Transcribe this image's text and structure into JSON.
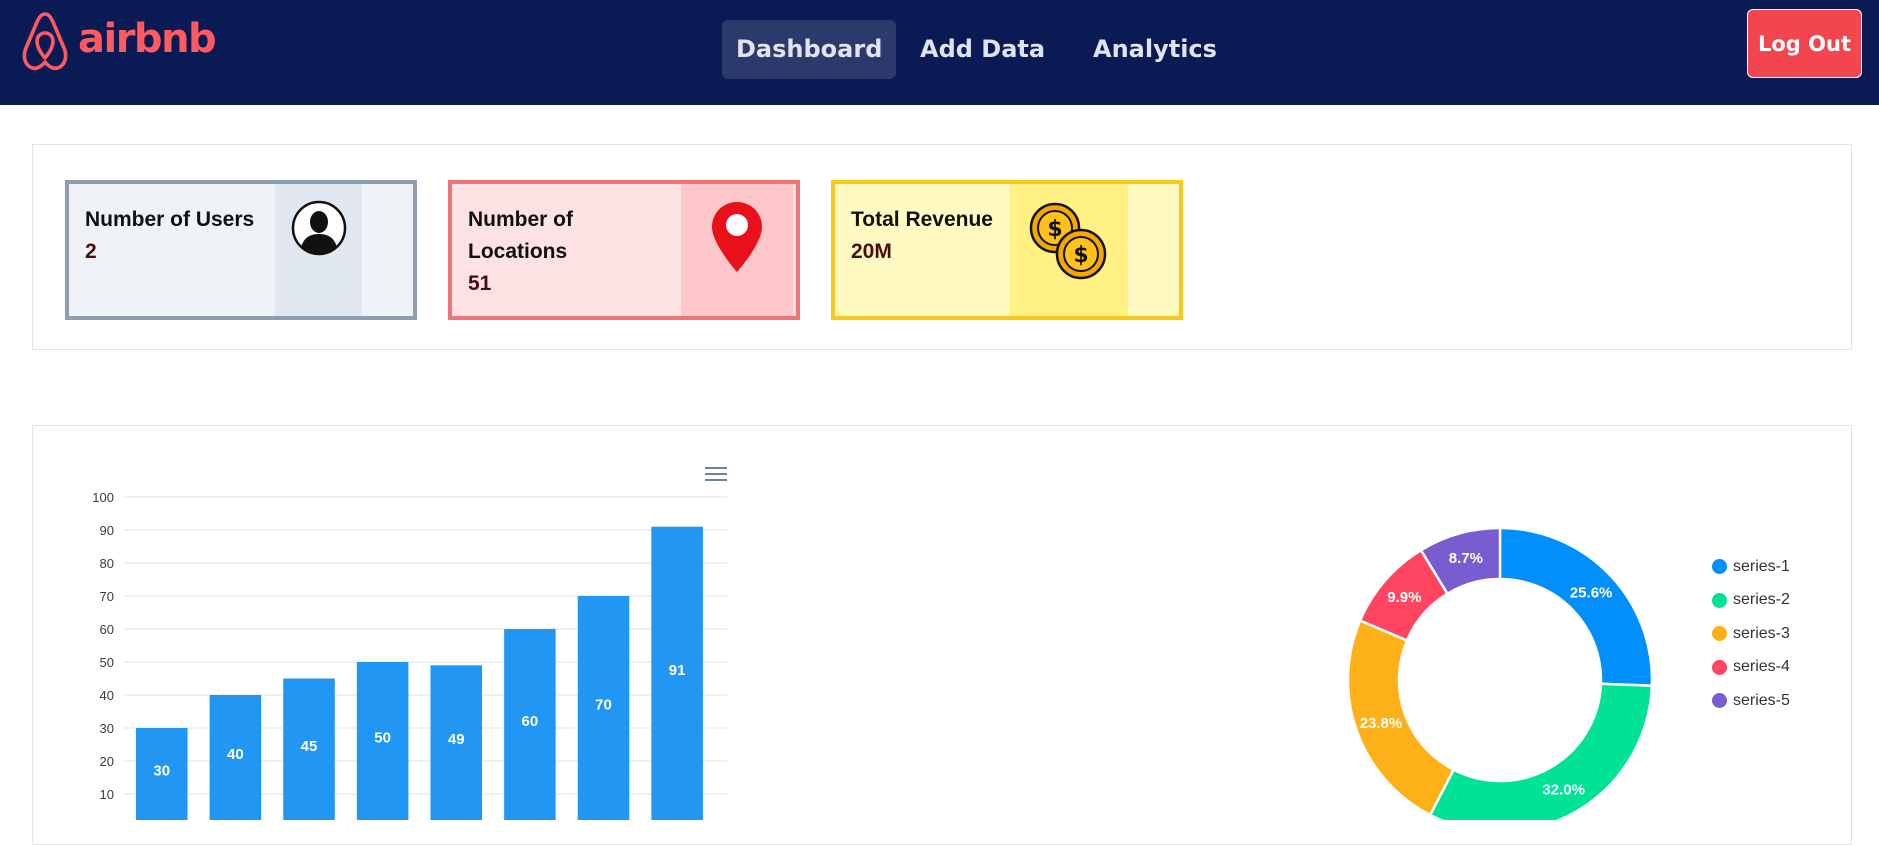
{
  "navbar": {
    "logo_text": "airbnb",
    "links": [
      {
        "label": "Dashboard",
        "active": true
      },
      {
        "label": "Add Data",
        "active": false
      },
      {
        "label": "Analytics",
        "active": false
      }
    ],
    "logout_label": "Log Out"
  },
  "stats": {
    "users": {
      "label": "Number of Users",
      "value": "2",
      "icon": "user-icon"
    },
    "locations": {
      "label": "Number of Locations",
      "value": "51",
      "icon": "map-pin-icon"
    },
    "revenue": {
      "label": "Total Revenue",
      "value": "20M",
      "icon": "coins-icon"
    }
  },
  "colors": {
    "nav_bg": "#0a1a55",
    "brand": "#ff5a5f",
    "bar": "#2196f3",
    "logout": "#f2454f"
  },
  "chart_data": [
    {
      "type": "bar",
      "title": "",
      "categories": [
        "",
        "",
        "",
        "",
        "",
        "",
        "",
        ""
      ],
      "values": [
        30,
        40,
        45,
        50,
        49,
        60,
        70,
        91
      ],
      "data_labels": true,
      "ylim": [
        0,
        100
      ],
      "yticks": [
        10,
        20,
        30,
        40,
        50,
        60,
        70,
        80,
        90,
        100
      ],
      "grid": true,
      "color": "#2196f3"
    },
    {
      "type": "pie",
      "donut": true,
      "series": [
        {
          "name": "series-1",
          "percent": 25.6,
          "label": "25.6%",
          "color": "#008ffb"
        },
        {
          "name": "series-2",
          "percent": 32.0,
          "label": "32.0%",
          "color": "#00e396"
        },
        {
          "name": "series-3",
          "percent": 23.8,
          "label": "23.8%",
          "color": "#feb019"
        },
        {
          "name": "series-4",
          "percent": 9.9,
          "label": "9.9%",
          "color": "#ff4560"
        },
        {
          "name": "series-5",
          "percent": 8.7,
          "label": "8.7%",
          "color": "#775dd0"
        }
      ],
      "legend": "right"
    }
  ]
}
